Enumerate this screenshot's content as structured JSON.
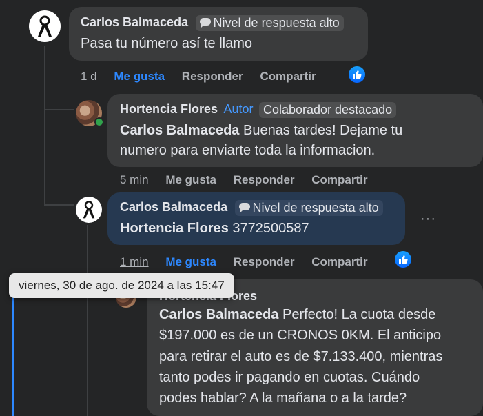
{
  "comments": [
    {
      "author": "Carlos Balmaceda",
      "badge": "Nivel de respuesta alto",
      "text": "Pasa tu número así te llamo",
      "time": "1 d",
      "like": "Me gusta",
      "reply": "Responder",
      "share": "Compartir"
    },
    {
      "author": "Hortencia Flores",
      "author_tag": "Autor",
      "badge": "Colaborador destacado",
      "mention": "Carlos Balmaceda",
      "text_line1": " Buenas tardes! Dejame tu",
      "text_line2": "numero para enviarte toda la informacion.",
      "time": "5 min",
      "like": "Me gusta",
      "reply": "Responder",
      "share": "Compartir"
    },
    {
      "author": "Carlos Balmaceda",
      "badge": "Nivel de respuesta alto",
      "mention": "Hortencia Flores",
      "text": " 3772500587",
      "time": "1 min",
      "like": "Me gusta",
      "reply": "Responder",
      "share": "Compartir",
      "more": "···"
    },
    {
      "author": "Hortencia Flores",
      "mention": "Carlos Balmaceda",
      "line1": " Perfecto! La cuota desde",
      "line2": "$197.000 es de un CRONOS 0KM. El anticipo",
      "line3": "para retirar el auto es de $7.133.400, mientras",
      "line4": "tanto podes ir pagando en cuotas. Cuándo",
      "line5": "podes hablar? A la mañana o a la tarde?"
    }
  ],
  "tooltip": "viernes, 30 de ago. de 2024 a las 15:47",
  "icons": {
    "like": "thumbs-up-icon",
    "badge": "speech-bubble-icon",
    "more": "more-options-icon"
  },
  "colors": {
    "background": "#242526",
    "bubble": "#3a3b3c",
    "bubble_highlight": "#263951",
    "accent": "#2d88ff"
  }
}
